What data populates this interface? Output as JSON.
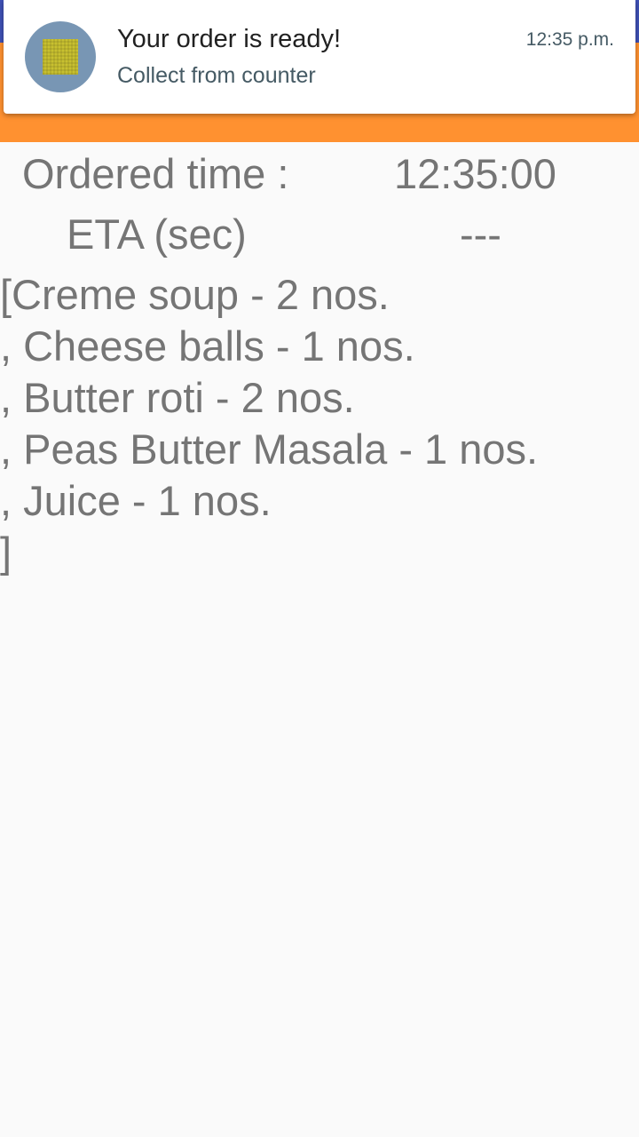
{
  "colors": {
    "status_bar": "#3f51b5",
    "app_bar": "#ff9130",
    "background": "#fafafa",
    "text": "#757575"
  },
  "notification": {
    "icon": "app-icon",
    "title": "Your order is ready!",
    "body": "Collect from counter",
    "time": "12:35 p.m."
  },
  "order": {
    "ordered_time_label": "Ordered time :",
    "ordered_time_value": "12:35:00",
    "eta_label": "ETA (sec)",
    "eta_value": "---",
    "items_text": "[Creme soup - 2 nos.\n, Cheese balls - 1 nos.\n, Butter roti - 2 nos.\n, Peas Butter Masala - 1 nos.\n, Juice - 1 nos.\n]"
  }
}
